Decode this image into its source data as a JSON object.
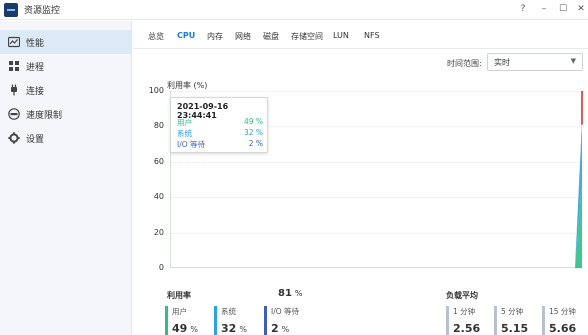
{
  "window": {
    "title": "资源监控",
    "buttons": {
      "help": "?",
      "minimize": "–",
      "maximize": "☐",
      "close": "✕"
    }
  },
  "sidebar": {
    "items": [
      {
        "label": "性能",
        "icon": "gauge-icon",
        "active": true
      },
      {
        "label": "进程",
        "icon": "process-icon",
        "active": false
      },
      {
        "label": "连接",
        "icon": "plug-icon",
        "active": false
      },
      {
        "label": "速度限制",
        "icon": "speed-limit-icon",
        "active": false
      },
      {
        "label": "设置",
        "icon": "gear-icon",
        "active": false
      }
    ]
  },
  "tabs": [
    {
      "label": "总览",
      "active": false
    },
    {
      "label": "CPU",
      "active": true
    },
    {
      "label": "内存",
      "active": false
    },
    {
      "label": "网络",
      "active": false
    },
    {
      "label": "磁盘",
      "active": false
    },
    {
      "label": "存储空间",
      "active": false
    },
    {
      "label": "LUN",
      "active": false
    },
    {
      "label": "NFS",
      "active": false
    }
  ],
  "time_range": {
    "label": "时间范围:",
    "value": "实时"
  },
  "chart": {
    "ylabel": "利用率 (%)",
    "yticks": [
      "100",
      "80",
      "60",
      "40",
      "20",
      "0"
    ]
  },
  "tooltip": {
    "time": "2021-09-16 23:44:41",
    "rows": [
      {
        "name": "用户",
        "value": "49 %"
      },
      {
        "name": "系统",
        "value": "32 %"
      },
      {
        "name": "I/O 等待",
        "value": "2 %"
      }
    ]
  },
  "utilization": {
    "label": "利用率",
    "total": "81",
    "total_unit": "%",
    "metrics": [
      {
        "name": "用户",
        "value": "49",
        "unit": "%"
      },
      {
        "name": "系统",
        "value": "32",
        "unit": "%"
      },
      {
        "name": "I/O 等待",
        "value": "2",
        "unit": "%"
      }
    ]
  },
  "load_average": {
    "label": "负载平均",
    "metrics": [
      {
        "name": "1 分钟",
        "value": "2.56"
      },
      {
        "name": "5 分钟",
        "value": "5.15"
      },
      {
        "name": "15 分钟",
        "value": "5.66"
      }
    ]
  },
  "colors": {
    "user": "#2dbf8a",
    "system": "#2aa3e0",
    "io_wait": "#3b5fb8",
    "total_line": "#d9272e",
    "accent": "#1a7ddb",
    "load": "#b8c2cc"
  },
  "chart_data": {
    "type": "area",
    "ylabel": "利用率 (%)",
    "ylim": [
      0,
      100
    ],
    "grid": true,
    "series": [
      {
        "name": "用户",
        "values": [
          0,
          49
        ]
      },
      {
        "name": "系统",
        "values": [
          0,
          32
        ]
      },
      {
        "name": "I/O 等待",
        "values": [
          0,
          2
        ]
      }
    ],
    "total_latest": 81
  }
}
